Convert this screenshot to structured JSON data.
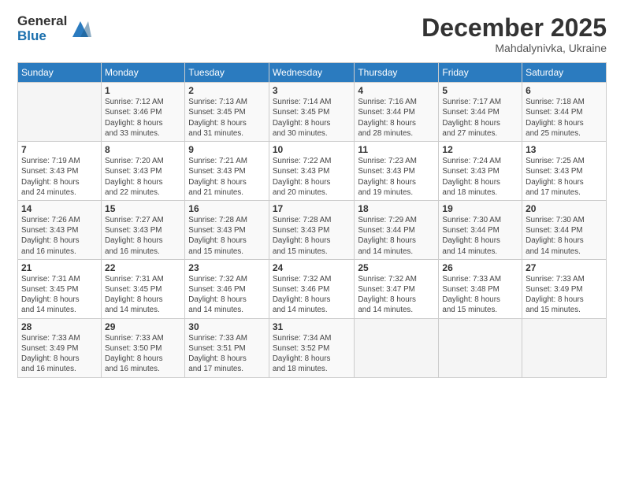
{
  "logo": {
    "general": "General",
    "blue": "Blue"
  },
  "calendar": {
    "title": "December 2025",
    "location": "Mahdalynivka, Ukraine",
    "days": [
      "Sunday",
      "Monday",
      "Tuesday",
      "Wednesday",
      "Thursday",
      "Friday",
      "Saturday"
    ],
    "weeks": [
      [
        {
          "num": "",
          "info": ""
        },
        {
          "num": "1",
          "info": "Sunrise: 7:12 AM\nSunset: 3:46 PM\nDaylight: 8 hours\nand 33 minutes."
        },
        {
          "num": "2",
          "info": "Sunrise: 7:13 AM\nSunset: 3:45 PM\nDaylight: 8 hours\nand 31 minutes."
        },
        {
          "num": "3",
          "info": "Sunrise: 7:14 AM\nSunset: 3:45 PM\nDaylight: 8 hours\nand 30 minutes."
        },
        {
          "num": "4",
          "info": "Sunrise: 7:16 AM\nSunset: 3:44 PM\nDaylight: 8 hours\nand 28 minutes."
        },
        {
          "num": "5",
          "info": "Sunrise: 7:17 AM\nSunset: 3:44 PM\nDaylight: 8 hours\nand 27 minutes."
        },
        {
          "num": "6",
          "info": "Sunrise: 7:18 AM\nSunset: 3:44 PM\nDaylight: 8 hours\nand 25 minutes."
        }
      ],
      [
        {
          "num": "7",
          "info": "Sunrise: 7:19 AM\nSunset: 3:43 PM\nDaylight: 8 hours\nand 24 minutes."
        },
        {
          "num": "8",
          "info": "Sunrise: 7:20 AM\nSunset: 3:43 PM\nDaylight: 8 hours\nand 22 minutes."
        },
        {
          "num": "9",
          "info": "Sunrise: 7:21 AM\nSunset: 3:43 PM\nDaylight: 8 hours\nand 21 minutes."
        },
        {
          "num": "10",
          "info": "Sunrise: 7:22 AM\nSunset: 3:43 PM\nDaylight: 8 hours\nand 20 minutes."
        },
        {
          "num": "11",
          "info": "Sunrise: 7:23 AM\nSunset: 3:43 PM\nDaylight: 8 hours\nand 19 minutes."
        },
        {
          "num": "12",
          "info": "Sunrise: 7:24 AM\nSunset: 3:43 PM\nDaylight: 8 hours\nand 18 minutes."
        },
        {
          "num": "13",
          "info": "Sunrise: 7:25 AM\nSunset: 3:43 PM\nDaylight: 8 hours\nand 17 minutes."
        }
      ],
      [
        {
          "num": "14",
          "info": "Sunrise: 7:26 AM\nSunset: 3:43 PM\nDaylight: 8 hours\nand 16 minutes."
        },
        {
          "num": "15",
          "info": "Sunrise: 7:27 AM\nSunset: 3:43 PM\nDaylight: 8 hours\nand 16 minutes."
        },
        {
          "num": "16",
          "info": "Sunrise: 7:28 AM\nSunset: 3:43 PM\nDaylight: 8 hours\nand 15 minutes."
        },
        {
          "num": "17",
          "info": "Sunrise: 7:28 AM\nSunset: 3:43 PM\nDaylight: 8 hours\nand 15 minutes."
        },
        {
          "num": "18",
          "info": "Sunrise: 7:29 AM\nSunset: 3:44 PM\nDaylight: 8 hours\nand 14 minutes."
        },
        {
          "num": "19",
          "info": "Sunrise: 7:30 AM\nSunset: 3:44 PM\nDaylight: 8 hours\nand 14 minutes."
        },
        {
          "num": "20",
          "info": "Sunrise: 7:30 AM\nSunset: 3:44 PM\nDaylight: 8 hours\nand 14 minutes."
        }
      ],
      [
        {
          "num": "21",
          "info": "Sunrise: 7:31 AM\nSunset: 3:45 PM\nDaylight: 8 hours\nand 14 minutes."
        },
        {
          "num": "22",
          "info": "Sunrise: 7:31 AM\nSunset: 3:45 PM\nDaylight: 8 hours\nand 14 minutes."
        },
        {
          "num": "23",
          "info": "Sunrise: 7:32 AM\nSunset: 3:46 PM\nDaylight: 8 hours\nand 14 minutes."
        },
        {
          "num": "24",
          "info": "Sunrise: 7:32 AM\nSunset: 3:46 PM\nDaylight: 8 hours\nand 14 minutes."
        },
        {
          "num": "25",
          "info": "Sunrise: 7:32 AM\nSunset: 3:47 PM\nDaylight: 8 hours\nand 14 minutes."
        },
        {
          "num": "26",
          "info": "Sunrise: 7:33 AM\nSunset: 3:48 PM\nDaylight: 8 hours\nand 15 minutes."
        },
        {
          "num": "27",
          "info": "Sunrise: 7:33 AM\nSunset: 3:49 PM\nDaylight: 8 hours\nand 15 minutes."
        }
      ],
      [
        {
          "num": "28",
          "info": "Sunrise: 7:33 AM\nSunset: 3:49 PM\nDaylight: 8 hours\nand 16 minutes."
        },
        {
          "num": "29",
          "info": "Sunrise: 7:33 AM\nSunset: 3:50 PM\nDaylight: 8 hours\nand 16 minutes."
        },
        {
          "num": "30",
          "info": "Sunrise: 7:33 AM\nSunset: 3:51 PM\nDaylight: 8 hours\nand 17 minutes."
        },
        {
          "num": "31",
          "info": "Sunrise: 7:34 AM\nSunset: 3:52 PM\nDaylight: 8 hours\nand 18 minutes."
        },
        {
          "num": "",
          "info": ""
        },
        {
          "num": "",
          "info": ""
        },
        {
          "num": "",
          "info": ""
        }
      ]
    ]
  }
}
